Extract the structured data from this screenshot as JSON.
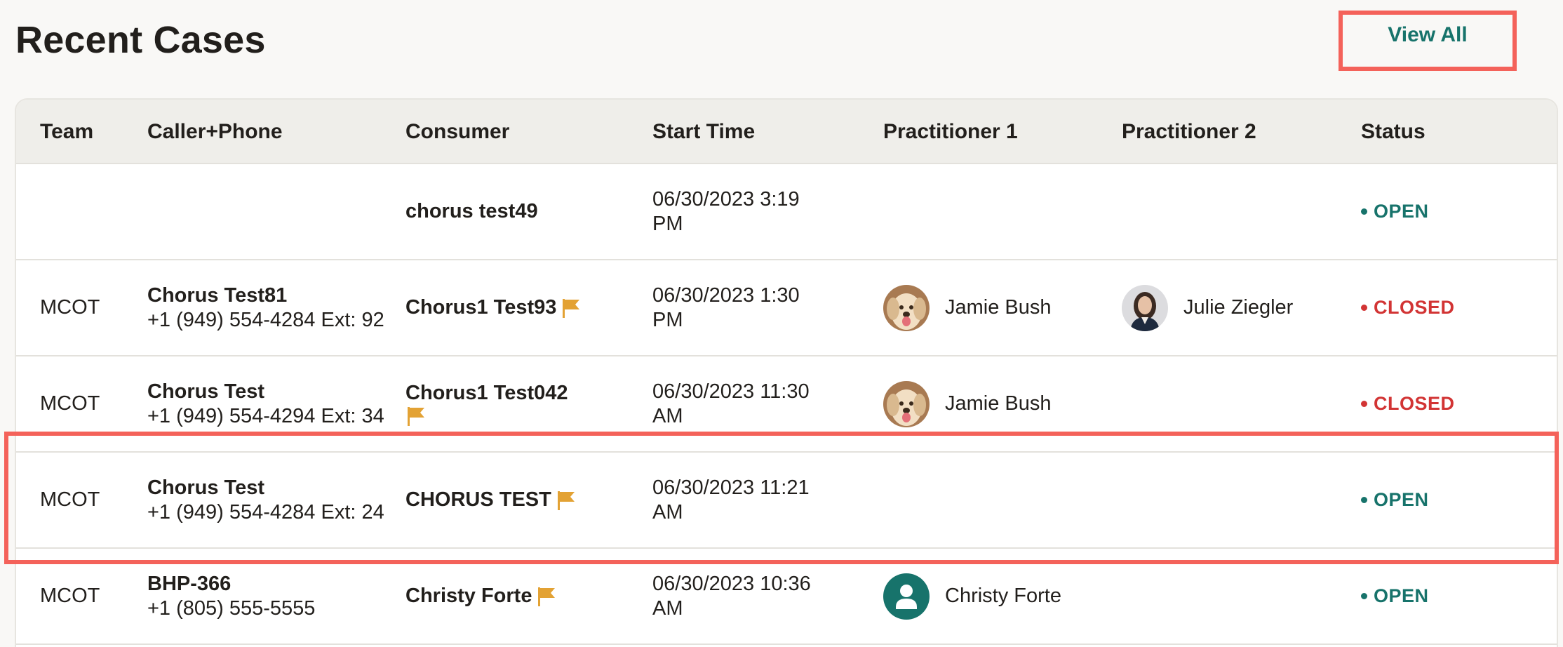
{
  "page_title": "Recent Cases",
  "view_all_label": "View All",
  "colors": {
    "accent_teal": "#17736b",
    "closed_red": "#d23434",
    "flag_orange": "#e3a234",
    "highlight_red": "#f4625a"
  },
  "table": {
    "headers": [
      "Team",
      "Caller+Phone",
      "Consumer",
      "Start Time",
      "Practitioner 1",
      "Practitioner 2",
      "Status"
    ],
    "rows": [
      {
        "team": "",
        "caller_name": "",
        "caller_phone": "",
        "consumer": "chorus test49",
        "consumer_flag": false,
        "start_time_line1": "06/30/2023 3:19",
        "start_time_line2": "PM",
        "practitioner1": "",
        "practitioner1_avatar": "",
        "practitioner2": "",
        "practitioner2_avatar": "",
        "status": "OPEN"
      },
      {
        "team": "MCOT",
        "caller_name": "Chorus Test81",
        "caller_phone": "+1 (949) 554-4284 Ext: 92",
        "consumer": "Chorus1 Test93",
        "consumer_flag": true,
        "start_time_line1": "06/30/2023 1:30",
        "start_time_line2": "PM",
        "practitioner1": "Jamie Bush",
        "practitioner1_avatar": "dog-photo-avatar",
        "practitioner2": "Julie Ziegler",
        "practitioner2_avatar": "woman-photo-avatar",
        "status": "CLOSED"
      },
      {
        "team": "MCOT",
        "caller_name": "Chorus Test",
        "caller_phone": "+1 (949) 554-4294 Ext: 34",
        "consumer": "Chorus1 Test042",
        "consumer_flag": true,
        "start_time_line1": "06/30/2023 11:30",
        "start_time_line2": "AM",
        "practitioner1": "Jamie Bush",
        "practitioner1_avatar": "dog-photo-avatar",
        "practitioner2": "",
        "practitioner2_avatar": "",
        "status": "CLOSED"
      },
      {
        "team": "MCOT",
        "caller_name": "Chorus Test",
        "caller_phone": "+1 (949) 554-4284 Ext: 24",
        "consumer": "CHORUS TEST",
        "consumer_flag": true,
        "start_time_line1": "06/30/2023 11:21",
        "start_time_line2": "AM",
        "practitioner1": "",
        "practitioner1_avatar": "",
        "practitioner2": "",
        "practitioner2_avatar": "",
        "status": "OPEN"
      },
      {
        "team": "MCOT",
        "caller_name": "BHP-366",
        "caller_phone": "+1 (805) 555-5555",
        "consumer": "Christy Forte",
        "consumer_flag": true,
        "start_time_line1": "06/30/2023 10:36",
        "start_time_line2": "AM",
        "practitioner1": "Christy Forte",
        "practitioner1_avatar": "default-user-avatar",
        "practitioner2": "",
        "practitioner2_avatar": "",
        "status": "OPEN"
      }
    ]
  }
}
